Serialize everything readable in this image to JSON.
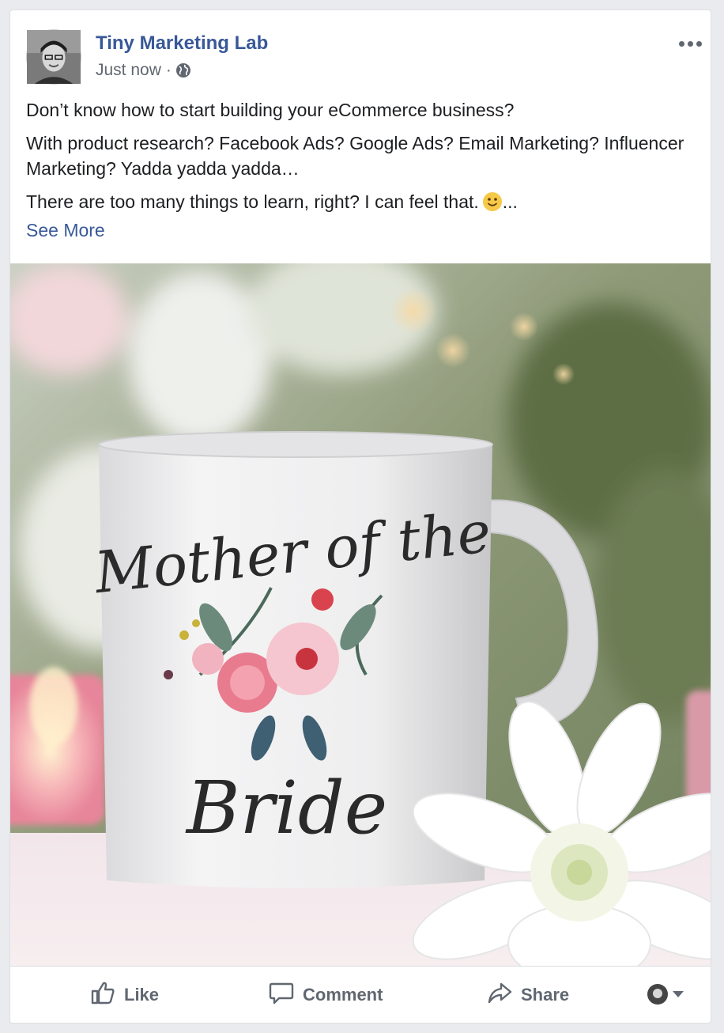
{
  "post": {
    "page_name": "Tiny Marketing Lab",
    "timestamp": "Just now",
    "separator": "·",
    "privacy_icon": "globe-icon",
    "paragraphs": [
      "Don’t know how to start building your eCommerce business?",
      "With product research? Facebook Ads? Google Ads? Email Marketing? Influencer Marketing? Yadda yadda yadda…",
      "There are too many things to learn, right? I can feel that."
    ],
    "emoji": "slightly-smiling-face-icon",
    "ellipsis": "...",
    "see_more": "See More"
  },
  "image": {
    "mug_text_top": "Mother of the",
    "mug_text_bottom": "Bride"
  },
  "actions": {
    "like": "Like",
    "comment": "Comment",
    "share": "Share"
  },
  "colors": {
    "link": "#385898",
    "text": "#1c1e21",
    "muted": "#606770",
    "background": "#e9ebee"
  }
}
